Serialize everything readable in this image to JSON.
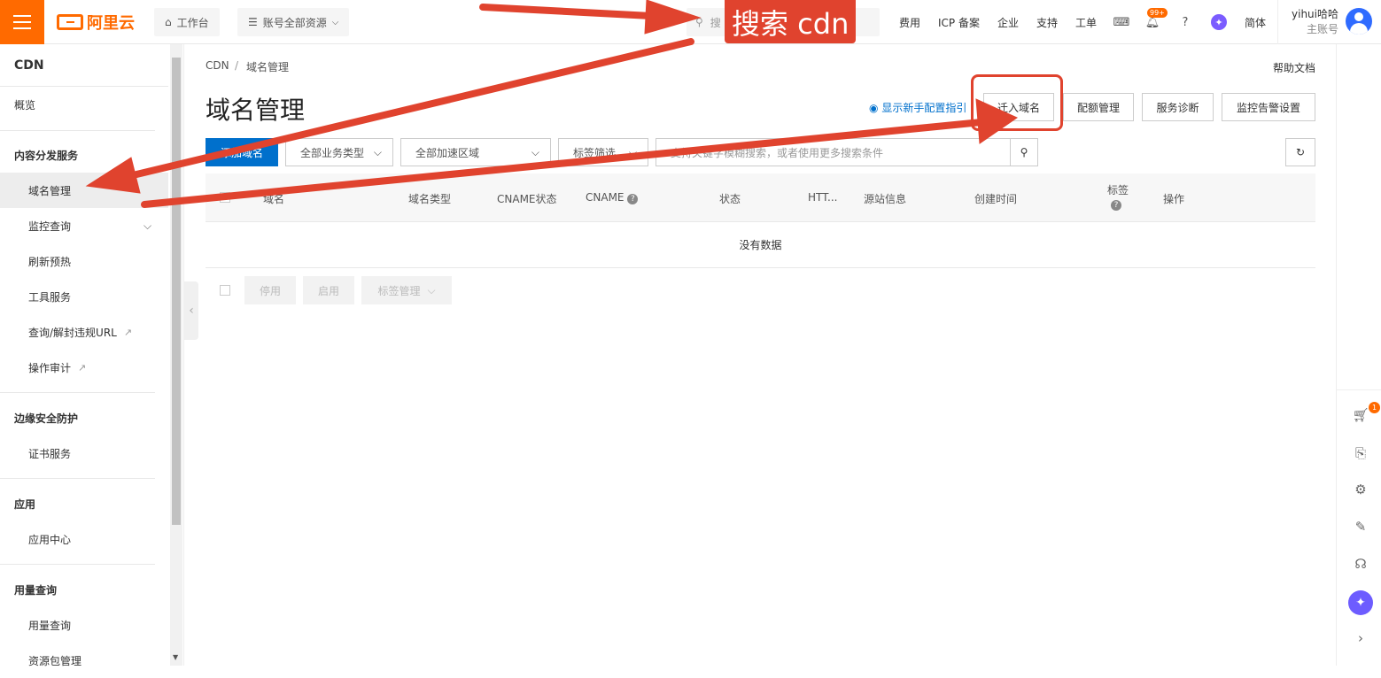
{
  "topbar": {
    "logo": "阿里云",
    "workbench": "工作台",
    "resources": "账号全部资源",
    "search_placeholder": "搜",
    "links": [
      "费用",
      "ICP 备案",
      "企业",
      "支持",
      "工单"
    ],
    "notification_badge": "99+",
    "language": "简体",
    "user_name": "yihui哈哈",
    "user_role": "主账号"
  },
  "sidebar": {
    "title": "CDN",
    "overview": "概览",
    "group_content": "内容分发服务",
    "domain_manage": "域名管理",
    "monitor": "监控查询",
    "refresh": "刷新预热",
    "tools": "工具服务",
    "url_query": "查询/解封违规URL",
    "audit": "操作审计",
    "group_security": "边缘安全防护",
    "cert": "证书服务",
    "group_app": "应用",
    "app_center": "应用中心",
    "group_usage": "用量查询",
    "usage": "用量查询",
    "package": "资源包管理"
  },
  "main": {
    "breadcrumb_root": "CDN",
    "breadcrumb_sep": "/",
    "breadcrumb_current": "域名管理",
    "help_doc": "帮助文档",
    "page_title": "域名管理",
    "guide_link": "显示新手配置指引",
    "migrate_button": "迁入域名",
    "quota_button": "配额管理",
    "diagnose_button": "服务诊断",
    "alert_button": "监控告警设置",
    "add_domain_button": "添加域名",
    "filter_business": "全部业务类型",
    "filter_region": "全部加速区域",
    "filter_tag": "标签筛选",
    "search_placeholder": "支持关键字模糊搜索，或者使用更多搜索条件",
    "columns": [
      "域名",
      "域名类型",
      "CNAME状态",
      "CNAME",
      "状态",
      "HTT...",
      "源站信息",
      "创建时间",
      "标签",
      "操作"
    ],
    "empty_text": "没有数据",
    "disable_button": "停用",
    "enable_button": "启用",
    "tag_manage_button": "标签管理"
  },
  "annotations": {
    "search_label": "搜索 cdn",
    "color": "#e0432e"
  },
  "rightbar": {
    "cart_badge": "1"
  },
  "colors": {
    "brand": "#ff6a00",
    "primary": "#0070cc",
    "annotation": "#e0432e"
  }
}
